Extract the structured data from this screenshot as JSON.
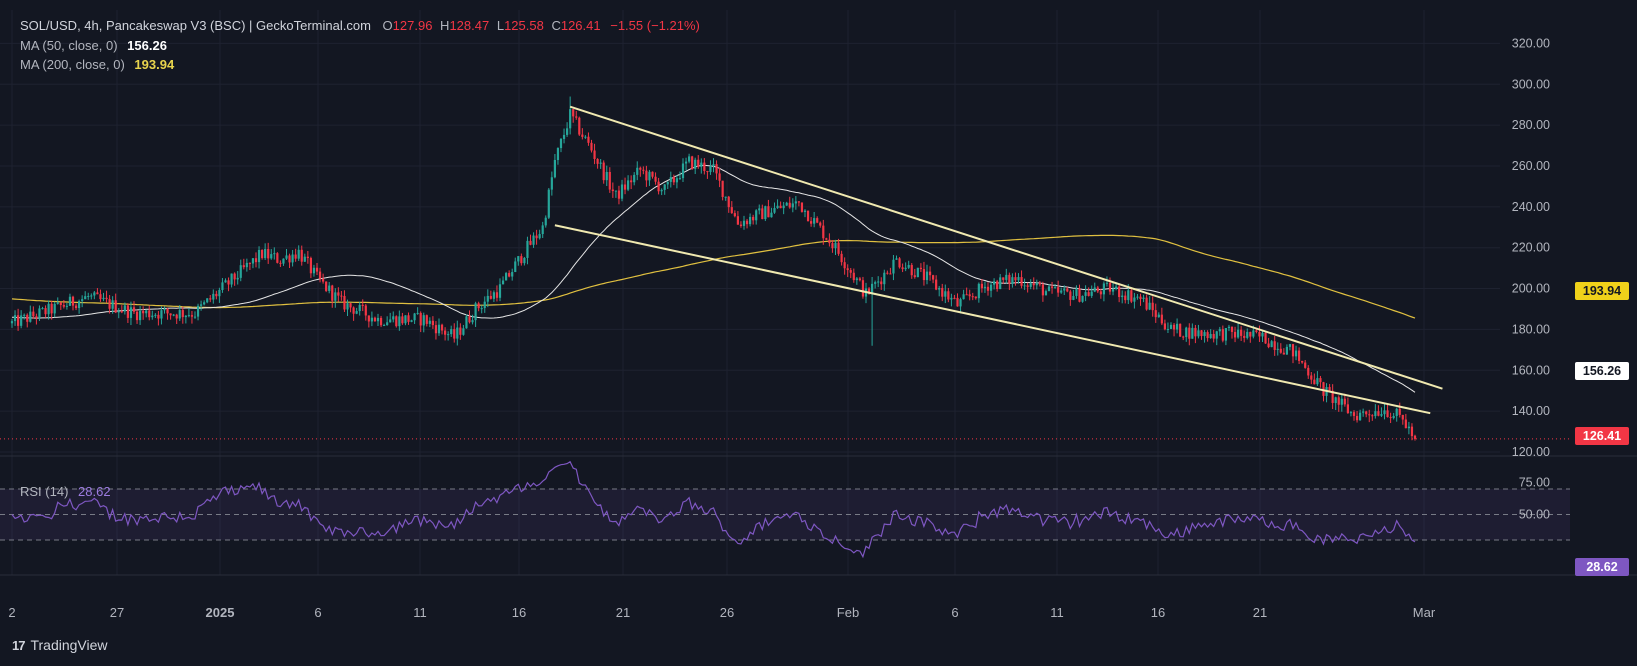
{
  "header": {
    "symbol": "SOL/USD, 4h, Pancakeswap V3 (BSC) | GeckoTerminal.com",
    "o_label": "O",
    "o": "127.96",
    "h_label": "H",
    "h": "128.47",
    "l_label": "L",
    "l": "125.58",
    "c_label": "C",
    "c": "126.41",
    "change": "−1.55 (−1.21%)",
    "ma50_label": "MA (50, close, 0)",
    "ma50_value": "156.26",
    "ma200_label": "MA (200, close, 0)",
    "ma200_value": "193.94",
    "rsi_label": "RSI (14)",
    "rsi_value": "28.62"
  },
  "price_tags": {
    "ma200": "193.94",
    "ma50": "156.26",
    "last": "126.41",
    "rsi": "28.62"
  },
  "footer": {
    "brand": "TradingView",
    "logo": "17"
  },
  "colors": {
    "background": "#131722",
    "up": "#26a69a",
    "down": "#f23645",
    "ma50": "#e6e6e6",
    "ma200": "#e0c040",
    "rsi": "#7e57c2",
    "trendline": "#f0e9b0"
  },
  "chart_data": {
    "type": "candlestick",
    "title": "SOL/USD, 4h",
    "price_axis": {
      "ticks": [
        "320.00",
        "300.00",
        "280.00",
        "260.00",
        "240.00",
        "220.00",
        "200.00",
        "180.00",
        "160.00",
        "140.00",
        "120.00"
      ],
      "range": [
        112,
        322
      ]
    },
    "rsi_axis": {
      "ticks": [
        "75.00",
        "50.00"
      ],
      "range": [
        15,
        95
      ]
    },
    "x_axis": {
      "ticks": [
        "2",
        "27",
        "2025",
        "6",
        "11",
        "16",
        "21",
        "26",
        "Feb",
        "6",
        "11",
        "16",
        "21",
        "Mar"
      ]
    },
    "price_anchors": [
      [
        0,
        183
      ],
      [
        25,
        196
      ],
      [
        40,
        188
      ],
      [
        60,
        188
      ],
      [
        75,
        208
      ],
      [
        82,
        217
      ],
      [
        88,
        214
      ],
      [
        94,
        218
      ],
      [
        100,
        205
      ],
      [
        108,
        193
      ],
      [
        120,
        185
      ],
      [
        135,
        185
      ],
      [
        145,
        176
      ],
      [
        152,
        190
      ],
      [
        160,
        200
      ],
      [
        168,
        218
      ],
      [
        174,
        230
      ],
      [
        178,
        262
      ],
      [
        183,
        285
      ],
      [
        190,
        268
      ],
      [
        198,
        245
      ],
      [
        206,
        258
      ],
      [
        214,
        248
      ],
      [
        222,
        262
      ],
      [
        230,
        258
      ],
      [
        238,
        232
      ],
      [
        248,
        238
      ],
      [
        258,
        242
      ],
      [
        270,
        220
      ],
      [
        280,
        197
      ],
      [
        290,
        214
      ],
      [
        300,
        205
      ],
      [
        310,
        192
      ],
      [
        320,
        202
      ],
      [
        330,
        205
      ],
      [
        340,
        198
      ],
      [
        350,
        197
      ],
      [
        360,
        200
      ],
      [
        370,
        195
      ],
      [
        380,
        180
      ],
      [
        390,
        178
      ],
      [
        400,
        178
      ],
      [
        410,
        176
      ],
      [
        420,
        169
      ],
      [
        430,
        150
      ],
      [
        440,
        138
      ],
      [
        450,
        141
      ],
      [
        456,
        136
      ],
      [
        460,
        126
      ]
    ],
    "spikes": [
      [
        282,
        172
      ],
      [
        183,
        294
      ]
    ],
    "ma50": {
      "name": "MA 50",
      "last": 156.26
    },
    "ma200": {
      "name": "MA 200",
      "last": 193.94
    },
    "rsi": {
      "name": "RSI (14)",
      "last": 28.62,
      "levels": [
        70,
        50,
        30
      ]
    },
    "trendlines": [
      {
        "from": [
          183,
          289
        ],
        "to": [
          469,
          151
        ]
      },
      {
        "from": [
          178,
          231
        ],
        "to": [
          465,
          139
        ]
      }
    ]
  }
}
